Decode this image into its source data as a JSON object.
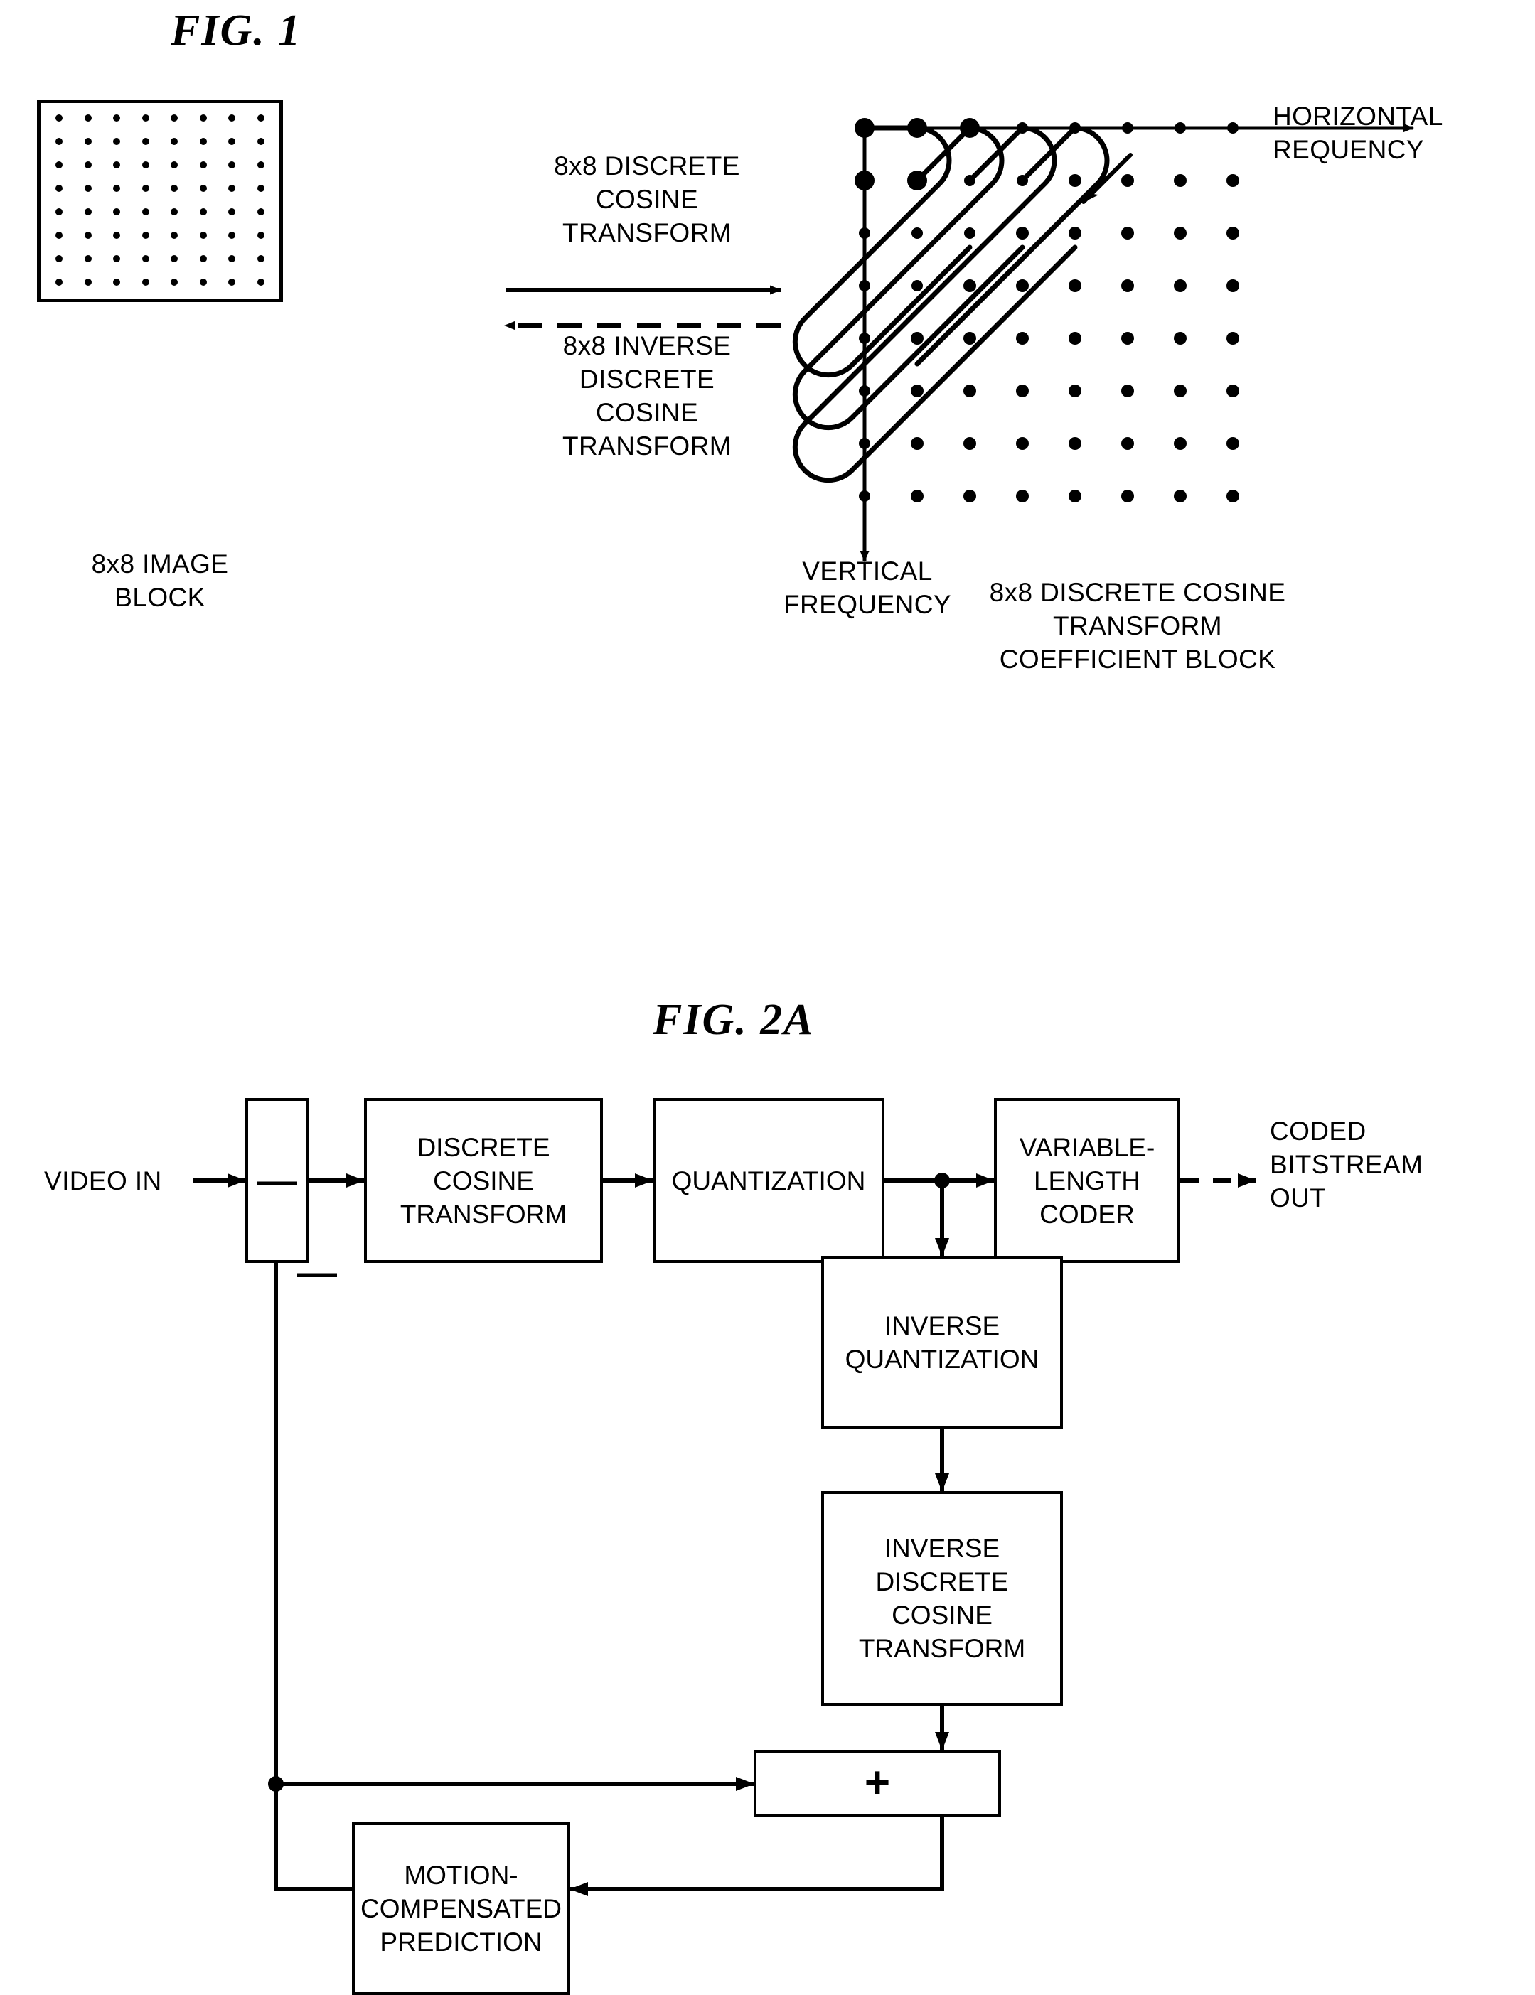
{
  "figures": {
    "fig1": {
      "title": "FIG. 1",
      "image_block_label": "8x8 IMAGE\nBLOCK",
      "forward_transform_label": "8x8 DISCRETE\nCOSINE\nTRANSFORM",
      "inverse_transform_label": "8x8 INVERSE\nDISCRETE\nCOSINE\nTRANSFORM",
      "horizontal_axis_label": "HORIZONTAL\nREQUENCY",
      "vertical_axis_label": "VERTICAL\nFREQUENCY",
      "coefficient_block_label": "8x8 DISCRETE COSINE\nTRANSFORM\nCOEFFICIENT BLOCK",
      "grid_rows": 8,
      "grid_cols": 8,
      "emphasized_coefficients": [
        [
          0,
          0
        ],
        [
          1,
          0
        ],
        [
          2,
          0
        ],
        [
          0,
          1
        ],
        [
          1,
          1
        ]
      ]
    },
    "fig2a": {
      "title": "FIG. 2A",
      "input_label": "VIDEO IN",
      "output_label": "CODED\nBITSTREAM\nOUT",
      "subtract_sign": "—",
      "feedback_minus_sign": "—",
      "add_sign": "+",
      "blocks": [
        {
          "id": "dct",
          "label": "DISCRETE\nCOSINE\nTRANSFORM"
        },
        {
          "id": "quant",
          "label": "QUANTIZATION"
        },
        {
          "id": "vlc",
          "label": "VARIABLE-\nLENGTH\nCODER"
        },
        {
          "id": "iquant",
          "label": "INVERSE\nQUANTIZATION"
        },
        {
          "id": "idct",
          "label": "INVERSE\nDISCRETE\nCOSINE\nTRANSFORM"
        },
        {
          "id": "mcp",
          "label": "MOTION-\nCOMPENSATED\nPREDICTION"
        }
      ]
    }
  },
  "colors": {
    "ink": "#000000",
    "paper": "#ffffff"
  }
}
